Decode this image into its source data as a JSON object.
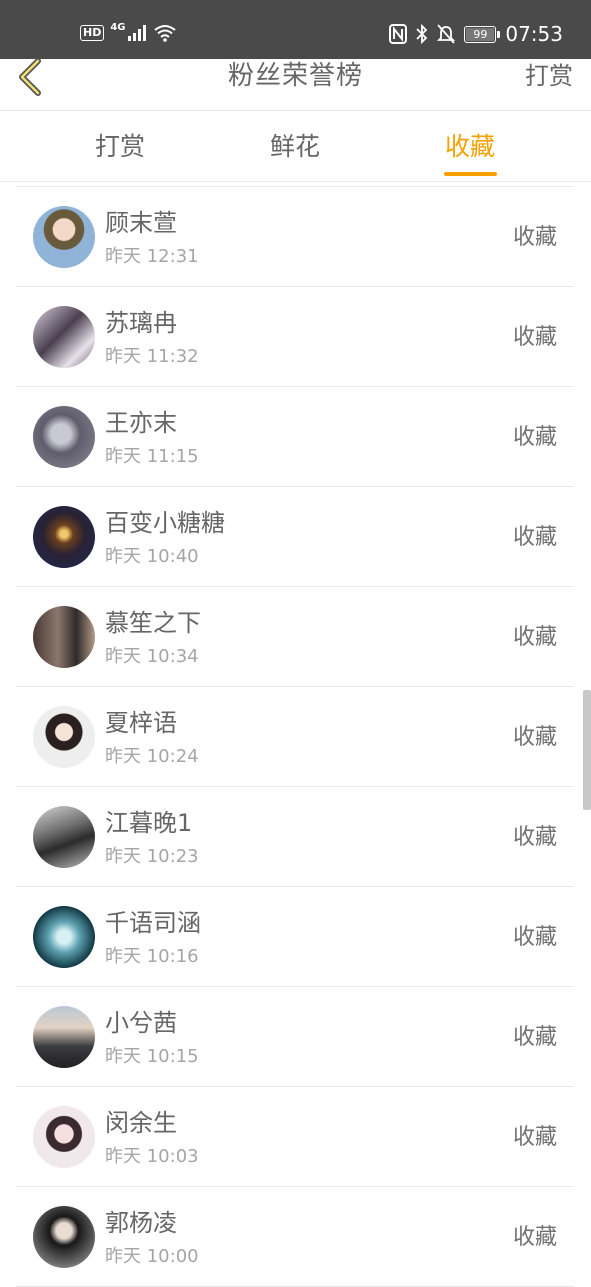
{
  "status_bar": {
    "hd": "HD",
    "network": "4G",
    "battery": "99",
    "time": "07:53"
  },
  "nav": {
    "title": "粉丝荣誉榜",
    "action": "打赏"
  },
  "tabs": [
    {
      "label": "打赏"
    },
    {
      "label": "鲜花"
    },
    {
      "label": "收藏"
    }
  ],
  "active_tab": "收藏",
  "accent_color": "#f5a200",
  "list": [
    {
      "name": "顾末萱",
      "time": "昨天 12:31",
      "action": "收藏"
    },
    {
      "name": "苏璃冉",
      "time": "昨天 11:32",
      "action": "收藏"
    },
    {
      "name": "王亦末",
      "time": "昨天 11:15",
      "action": "收藏"
    },
    {
      "name": "百变小糖糖",
      "time": "昨天 10:40",
      "action": "收藏"
    },
    {
      "name": "慕笙之下",
      "time": "昨天 10:34",
      "action": "收藏"
    },
    {
      "name": "夏梓语",
      "time": "昨天 10:24",
      "action": "收藏"
    },
    {
      "name": "江暮晚1",
      "time": "昨天 10:23",
      "action": "收藏"
    },
    {
      "name": "千语司涵",
      "time": "昨天 10:16",
      "action": "收藏"
    },
    {
      "name": "小兮茜",
      "time": "昨天 10:15",
      "action": "收藏"
    },
    {
      "name": "闵余生",
      "time": "昨天 10:03",
      "action": "收藏"
    },
    {
      "name": "郭杨凌",
      "time": "昨天 10:00",
      "action": "收藏"
    }
  ]
}
